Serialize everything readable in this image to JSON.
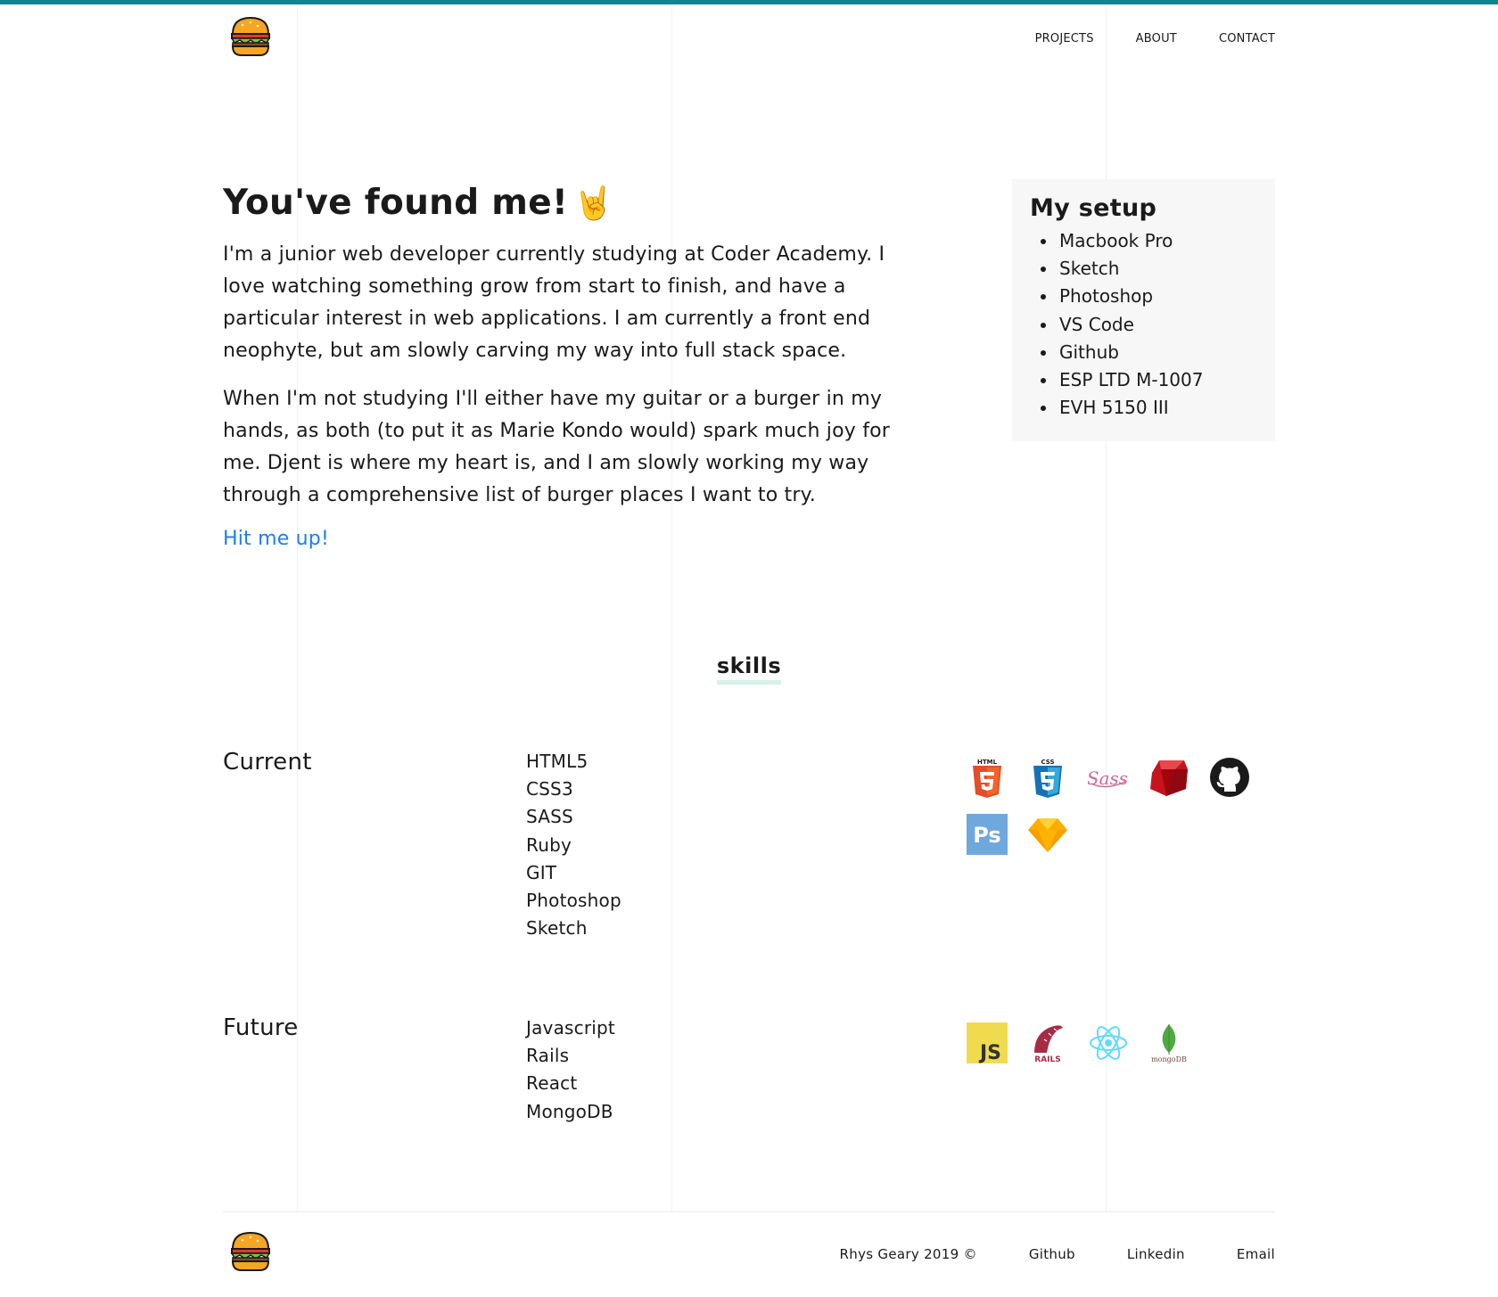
{
  "header": {
    "logo": "burger-icon",
    "nav": [
      "PROJECTS",
      "ABOUT",
      "CONTACT"
    ]
  },
  "intro": {
    "title": "You've found me!",
    "emoji": "🤘",
    "paragraphs": [
      "I'm a junior web developer currently studying at Coder Academy. I love watching something grow from start to finish, and have a particular interest in web applications. I am currently a front end neophyte, but am slowly carving my way into full stack space.",
      "When I'm not studying I'll either have my guitar or a burger in my hands, as both (to put it as Marie Kondo would) spark much joy for me. Djent is where my heart is, and I am slowly working my way through a comprehensive list of burger places I want to try."
    ],
    "cta": "Hit me up!"
  },
  "setup": {
    "title": "My setup",
    "items": [
      "Macbook Pro",
      "Sketch",
      "Photoshop",
      "VS Code",
      "Github",
      "ESP LTD M-1007",
      "EVH 5150 III"
    ]
  },
  "skills": {
    "title": "skills",
    "current": {
      "label": "Current",
      "items": [
        "HTML5",
        "CSS3",
        "SASS",
        "Ruby",
        "GIT",
        "Photoshop",
        "Sketch"
      ],
      "icons": [
        "html5-icon",
        "css3-icon",
        "sass-icon",
        "ruby-icon",
        "github-icon",
        "photoshop-icon",
        "sketch-icon"
      ]
    },
    "future": {
      "label": "Future",
      "items": [
        "Javascript",
        "Rails",
        "React",
        "MongoDB"
      ],
      "icons": [
        "javascript-icon",
        "rails-icon",
        "react-icon",
        "mongodb-icon"
      ]
    }
  },
  "footer": {
    "copyright": "Rhys Geary 2019 ©",
    "links": [
      "Github",
      "Linkedin",
      "Email"
    ]
  },
  "colors": {
    "topbar": "#12848f",
    "link": "#1a7ff1",
    "card": "#f7f7f7",
    "underline": "#d6f1ec"
  }
}
